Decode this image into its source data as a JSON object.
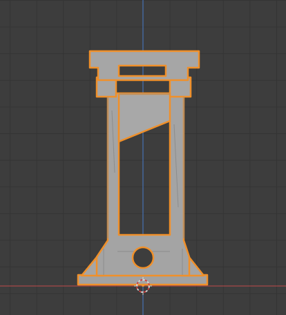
{
  "viewport": {
    "view": "front-orthographic",
    "background_color": "#3d3d3d",
    "grid_color": "#343434",
    "axis_colors": {
      "z_axis": "#4a7fd0",
      "x_axis": "#c24a4a"
    }
  },
  "object": {
    "kind": "guillotine-model",
    "selected": true,
    "selection_outline_color": "#f0902a",
    "mesh_fill_color": "#a4a4a4"
  },
  "cursor_3d": {
    "icon": "3d-cursor-icon",
    "colors": [
      "#d9d9d9",
      "#d23a3a"
    ]
  }
}
